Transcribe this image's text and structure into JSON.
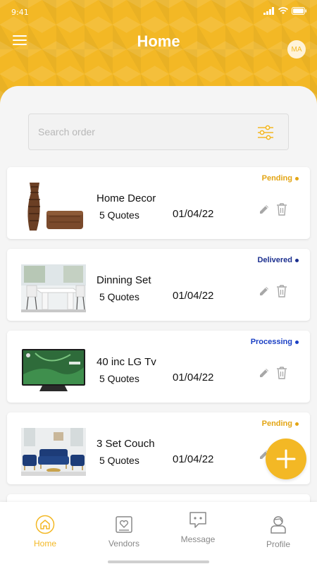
{
  "status_bar": {
    "time": "9:41"
  },
  "header": {
    "title": "Home",
    "avatar_initials": "MA"
  },
  "search": {
    "placeholder": "Search order"
  },
  "colors": {
    "brand": "#f3b825",
    "pending": "#e3a514",
    "delivered": "#1b2f8f",
    "processing": "#1a3fc4",
    "icon_gray": "#a7a7a7"
  },
  "orders": [
    {
      "title": "Home Decor",
      "quotes": "5 Quotes",
      "date": "01/04/22",
      "status": "Pending",
      "image": "vases-icon"
    },
    {
      "title": "Dinning Set",
      "quotes": "5 Quotes",
      "date": "01/04/22",
      "status": "Delivered",
      "image": "dining-table-icon"
    },
    {
      "title": "40 inc LG Tv",
      "quotes": "5 Quotes",
      "date": "01/04/22",
      "status": "Processing",
      "image": "tv-icon"
    },
    {
      "title": "3 Set Couch",
      "quotes": "5 Quotes",
      "date": "01/04/22",
      "status": "Pending",
      "image": "couch-icon"
    }
  ],
  "tabs": [
    {
      "label": "Home",
      "icon": "home-icon",
      "active": true
    },
    {
      "label": "Vendors",
      "icon": "vendors-icon",
      "active": false
    },
    {
      "label": "Message",
      "icon": "message-icon",
      "active": false
    },
    {
      "label": "Profile",
      "icon": "profile-icon",
      "active": false
    }
  ]
}
